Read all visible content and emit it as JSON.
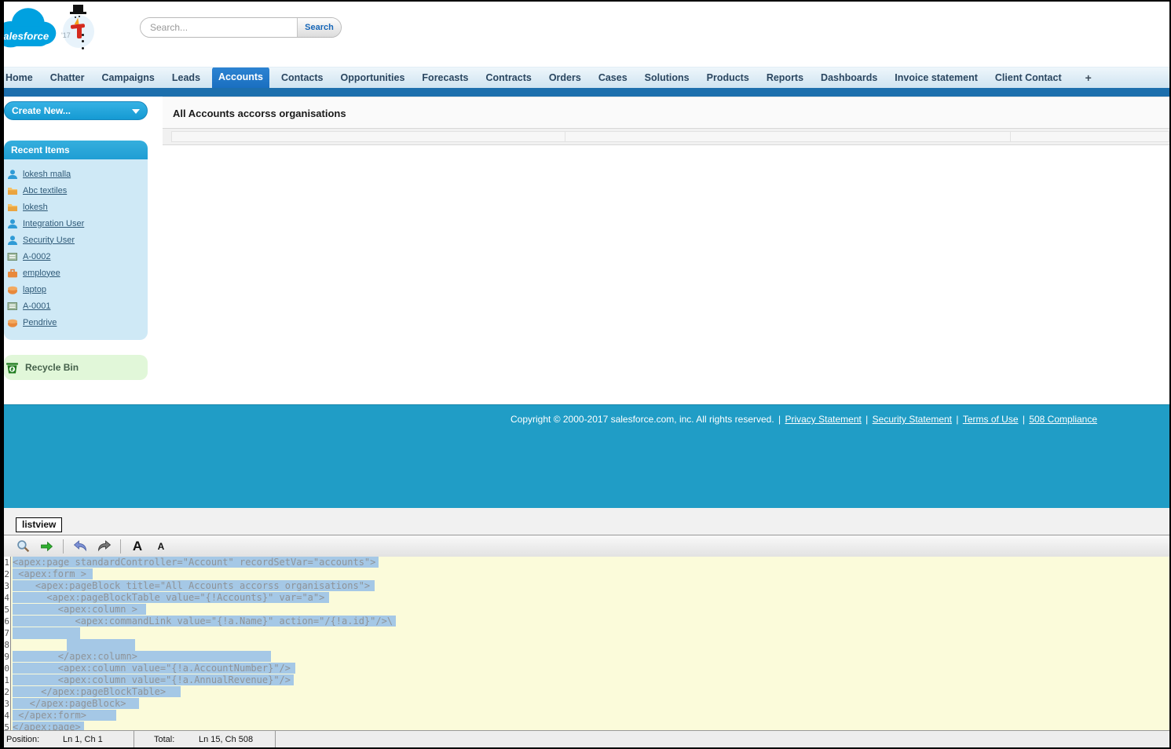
{
  "header": {
    "logo_text": "salesforce",
    "snowman_year": "'17",
    "search": {
      "placeholder": "Search...",
      "button_label": "Search"
    }
  },
  "tabs": {
    "items": [
      {
        "label": "Home",
        "selected": false
      },
      {
        "label": "Chatter",
        "selected": false
      },
      {
        "label": "Campaigns",
        "selected": false
      },
      {
        "label": "Leads",
        "selected": false
      },
      {
        "label": "Accounts",
        "selected": true
      },
      {
        "label": "Contacts",
        "selected": false
      },
      {
        "label": "Opportunities",
        "selected": false
      },
      {
        "label": "Forecasts",
        "selected": false
      },
      {
        "label": "Contracts",
        "selected": false
      },
      {
        "label": "Orders",
        "selected": false
      },
      {
        "label": "Cases",
        "selected": false
      },
      {
        "label": "Solutions",
        "selected": false
      },
      {
        "label": "Products",
        "selected": false
      },
      {
        "label": "Reports",
        "selected": false
      },
      {
        "label": "Dashboards",
        "selected": false
      },
      {
        "label": "Invoice statement",
        "selected": false
      },
      {
        "label": "Client Contact",
        "selected": false
      }
    ],
    "add_tab_label": "+"
  },
  "sidebar": {
    "create_new_label": "Create New...",
    "recent_items_title": "Recent Items",
    "recent_items": [
      {
        "label": "lokesh malla",
        "icon": "user"
      },
      {
        "label": "Abc textiles",
        "icon": "folder"
      },
      {
        "label": "lokesh",
        "icon": "folder"
      },
      {
        "label": "Integration User",
        "icon": "user"
      },
      {
        "label": "Security User",
        "icon": "user"
      },
      {
        "label": "A-0002",
        "icon": "invoice"
      },
      {
        "label": "employee",
        "icon": "case"
      },
      {
        "label": "laptop",
        "icon": "product"
      },
      {
        "label": "A-0001",
        "icon": "invoice"
      },
      {
        "label": "Pendrive",
        "icon": "product"
      }
    ],
    "recycle_bin_label": "Recycle Bin"
  },
  "main": {
    "page_title": "All Accounts accorss organisations"
  },
  "footer": {
    "copyright": "Copyright © 2000-2017 salesforce.com, inc. All rights reserved.",
    "links": [
      "Privacy Statement",
      "Security Statement",
      "Terms of Use",
      "508 Compliance"
    ]
  },
  "editor": {
    "tab_label": "listview",
    "toolbar": [
      {
        "name": "search",
        "icon": "magnifier-icon"
      },
      {
        "name": "go",
        "icon": "green-arrow-icon"
      },
      {
        "name": "undo",
        "icon": "undo-arrow-icon"
      },
      {
        "name": "redo",
        "icon": "redo-arrow-icon"
      },
      {
        "name": "font-increase",
        "label": "A"
      },
      {
        "name": "font-decrease",
        "label": "A"
      }
    ],
    "code_lines": [
      "<apex:page standardController=\"Account\" recordSetVar=\"accounts\">",
      " <apex:form >",
      "    <apex:pageBlock title=\"All Accounts accorss organisations\">",
      "      <apex:pageBlockTable value=\"{!Accounts}\" var=\"a\">",
      "        <apex:column >",
      "           <apex:commandLink value=\"{!a.Name}\" action=\"/{!a.id}\"/>\\",
      "",
      "",
      "        </apex:column>",
      "        <apex:column value=\"{!a.AccountNumber}\"/>",
      "        <apex:column value=\"{!a.AnnualRevenue}\"/>",
      "     </apex:pageBlockTable>",
      "   </apex:pageBlock>",
      " </apex:form>",
      "</apex:page>"
    ],
    "status": {
      "position_label": "Position:",
      "position_value": "Ln 1, Ch 1",
      "total_label": "Total:",
      "total_value": "Ln 15, Ch 508"
    }
  },
  "colors": {
    "salesforce_blue": "#00a1e0",
    "selected_tab_blue": "#1e76c2",
    "nav_bar_blue": "#1d6fad",
    "footer_teal": "#209dc6",
    "sidebar_header_blue": "#2aa9d9",
    "sidebar_body_blue": "#cfe9f6",
    "recycle_bin_green": "#e1f7d9",
    "code_background": "#fbfbda",
    "code_selection": "#a5c8e6"
  }
}
